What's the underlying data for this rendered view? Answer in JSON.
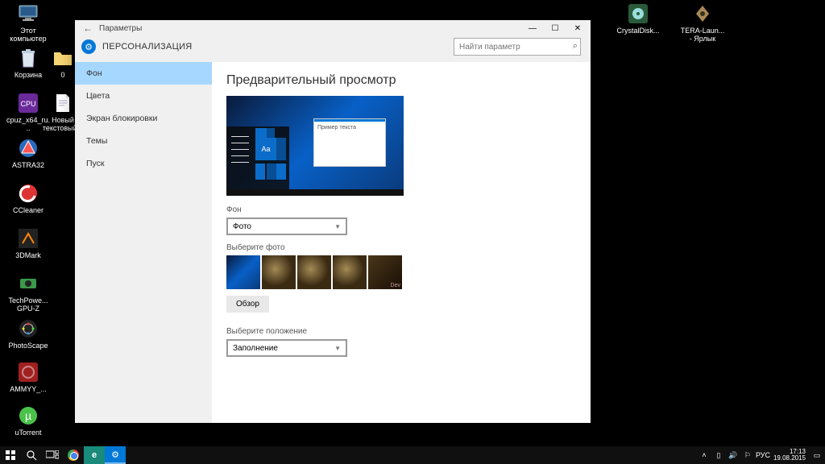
{
  "desktop": {
    "col1": [
      {
        "label": "Этот компьютер"
      },
      {
        "label": "Корзина"
      },
      {
        "label": "cpuz_x64_ru..."
      },
      {
        "label": "ASTRA32"
      },
      {
        "label": "CCleaner"
      },
      {
        "label": "3DMark"
      },
      {
        "label": "TechPowe... GPU-Z"
      },
      {
        "label": "PhotoScape"
      },
      {
        "label": "AMMYY_..."
      },
      {
        "label": "uTorrent"
      }
    ],
    "col2": [
      {
        "label": "0"
      },
      {
        "label": "Новый текстовый..."
      }
    ],
    "colR": [
      {
        "label": "CrystalDisk..."
      },
      {
        "label": "TERA-Laun... - Ярлык"
      }
    ]
  },
  "settings": {
    "title": "Параметры",
    "heading": "ПЕРСОНАЛИЗАЦИЯ",
    "search_placeholder": "Найти параметр",
    "sidebar": [
      {
        "label": "Фон",
        "active": true
      },
      {
        "label": "Цвета"
      },
      {
        "label": "Экран блокировки"
      },
      {
        "label": "Темы"
      },
      {
        "label": "Пуск"
      }
    ],
    "content": {
      "preview_heading": "Предварительный просмотр",
      "preview_sample_text": "Пример текста",
      "preview_tile_aa": "Aa",
      "bg_label": "Фон",
      "bg_value": "Фото",
      "choose_photo_label": "Выберите фото",
      "browse_label": "Обзор",
      "fit_label": "Выберите положение",
      "fit_value": "Заполнение"
    }
  },
  "taskbar": {
    "lang": "РУС",
    "time": "17:13",
    "date": "19.08.2015"
  }
}
